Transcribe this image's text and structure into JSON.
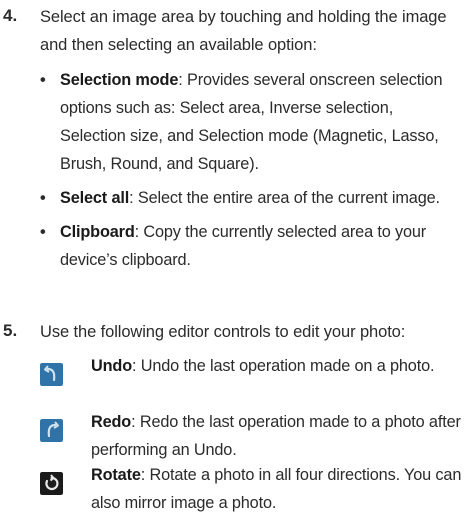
{
  "step4": {
    "number": "4.",
    "text": "Select an image area by touching and holding the image and then selecting an available option:",
    "bullets": [
      {
        "term": "Selection mode",
        "sep": ": ",
        "desc": "Provides several onscreen selection options such as: Select area, Inverse selection, Selection size, and Selection mode (Magnetic, Lasso, Brush, Round, and Square)."
      },
      {
        "term": "Select all",
        "sep": ": ",
        "desc": "Select the entire area of the current image."
      },
      {
        "term": "Clipboard",
        "sep": ": ",
        "desc": "Copy the currently selected area to your device’s clipboard."
      }
    ]
  },
  "step5": {
    "number": "5.",
    "text": "Use the following editor controls to edit your photo:",
    "tools": [
      {
        "icon": "undo-icon",
        "term": "Undo",
        "sep": ": ",
        "desc": "Undo the last operation made on a photo."
      },
      {
        "icon": "redo-icon",
        "term": "Redo",
        "sep": ": ",
        "desc": "Redo the last operation made to a photo after performing an Undo."
      },
      {
        "icon": "rotate-icon",
        "term": "Rotate",
        "sep": ": ",
        "desc": "Rotate a photo in all four directions. You can also mirror image a photo."
      }
    ]
  },
  "colors": {
    "icon_bg": "#2f73a8",
    "icon_bg_dark": "#1b1b1b",
    "icon_glyph": "#cfe3f3"
  }
}
